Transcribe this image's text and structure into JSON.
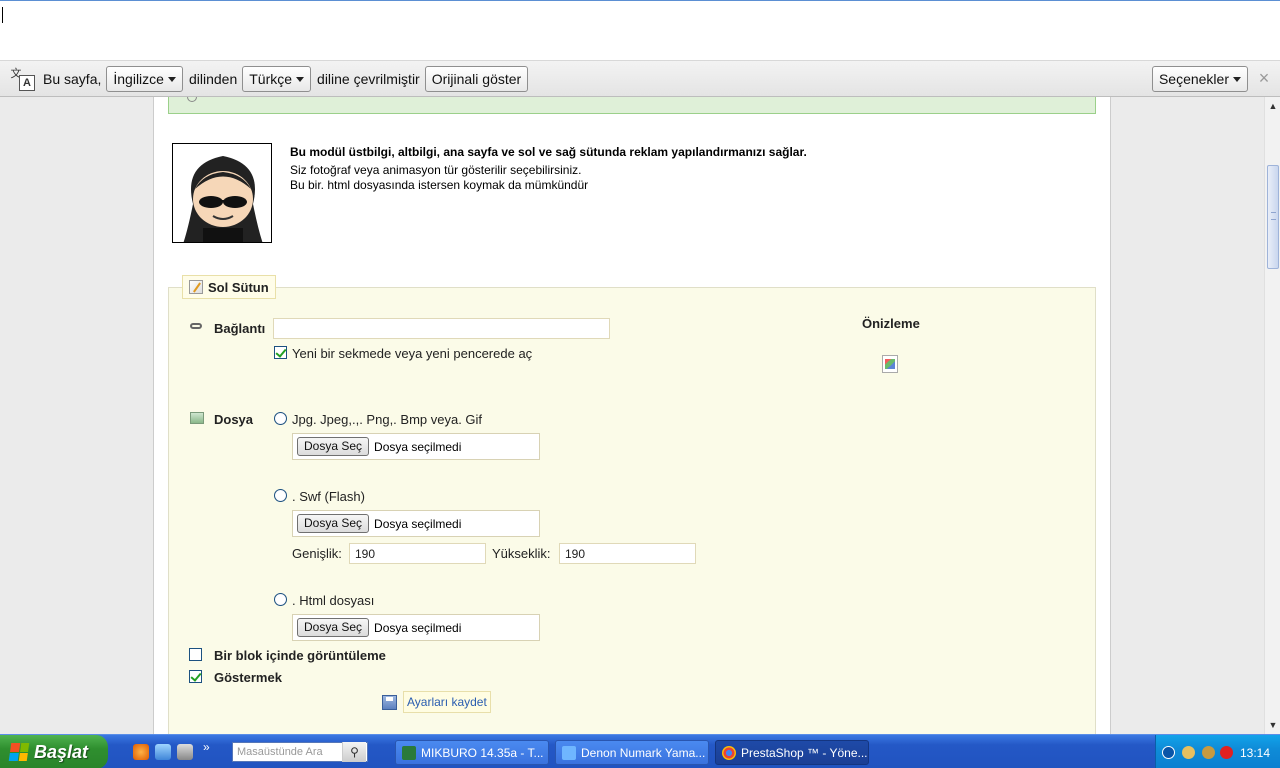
{
  "translate_bar": {
    "prefix": "Bu sayfa,",
    "source_lang": "İngilizce",
    "middle": "dilinden",
    "target_lang": "Türkçe",
    "suffix": "diline çevrilmiştir",
    "show_original": "Orijinali göster",
    "options": "Seçenekler",
    "close": "×"
  },
  "module_info": {
    "headline": "Bu modül üstbilgi, altbilgi, ana sayfa ve sol ve sağ sütunda reklam yapılandırmanızı sağlar.",
    "line1": "Siz fotoğraf veya animasyon tür gösterilir seçebilirsiniz.",
    "line2": "Bu bir. html dosyasında istersen koymak da mümkündür"
  },
  "section": {
    "title": "Sol Sütun",
    "link_label": "Bağlantı",
    "link_value": "",
    "new_tab_label": "Yeni bir sekmede veya yeni pencerede aç",
    "new_tab_checked": true,
    "preview_label": "Önizleme",
    "file_label": "Dosya",
    "options": [
      {
        "label": "Jpg. Jpeg,.,. Png,. Bmp veya. Gif",
        "button": "Dosya Seç",
        "status": "Dosya seçilmedi"
      },
      {
        "label": ". Swf (Flash)",
        "button": "Dosya Seç",
        "status": "Dosya seçilmedi"
      },
      {
        "label": ". Html dosyası",
        "button": "Dosya Seç",
        "status": "Dosya seçilmedi"
      }
    ],
    "width_label": "Genişlik:",
    "width_value": "190",
    "height_label": "Yükseklik:",
    "height_value": "190",
    "block_label": "Bir blok içinde görüntüleme",
    "block_checked": false,
    "show_label": "Göstermek",
    "show_checked": true,
    "save_label": "Ayarları kaydet"
  },
  "taskbar": {
    "start_label": "Başlat",
    "search_placeholder": "Masaüstünde Ara",
    "tasks": [
      {
        "label": "MIKBURO 14.35a - T..."
      },
      {
        "label": "Denon Numark Yama..."
      },
      {
        "label": "PrestaShop ™ - Yöne..."
      }
    ],
    "clock": "13:14"
  },
  "colors": {
    "accent": "#2458c6",
    "fieldset_bg": "#fbfbe8",
    "success_bg": "#dff0d8"
  }
}
